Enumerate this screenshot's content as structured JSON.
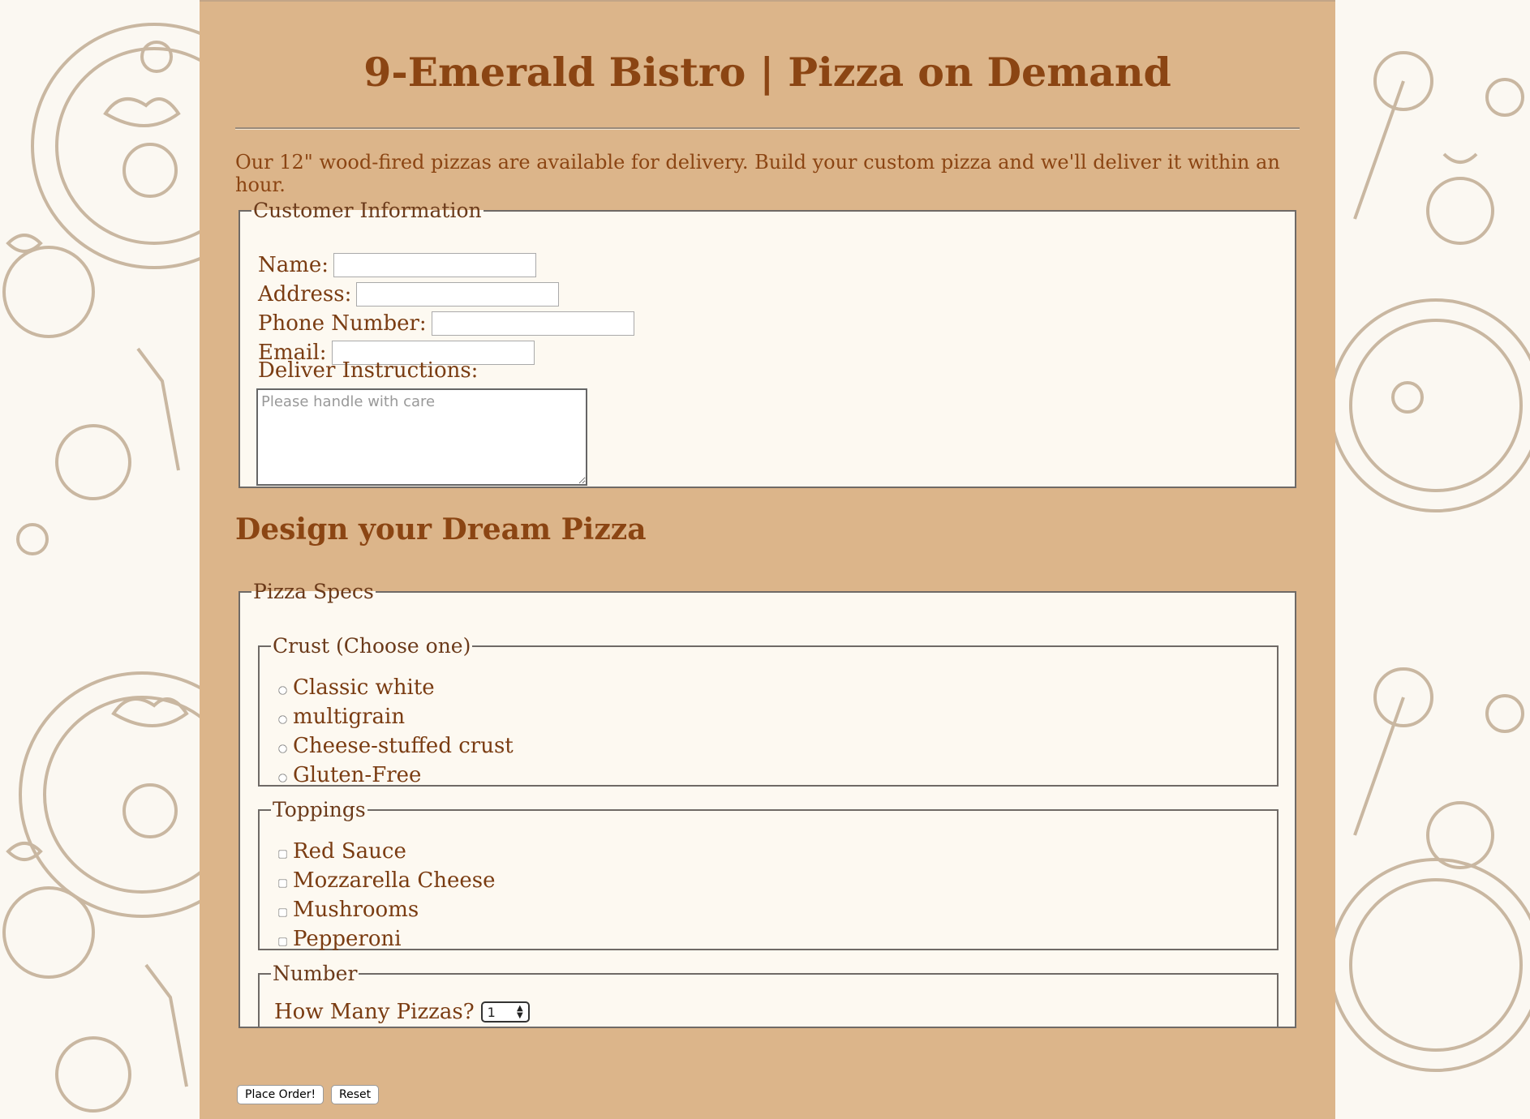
{
  "header": {
    "title": "9-Emerald Bistro | Pizza on Demand",
    "intro": "Our 12\" wood-fired pizzas are available for delivery. Build your custom pizza and we'll deliver it within an hour."
  },
  "customer": {
    "legend": "Customer Information",
    "name_label": "Name:",
    "address_label": "Address:",
    "phone_label": "Phone Number:",
    "email_label": "Email:",
    "instructions_label": "Deliver Instructions:",
    "instructions_placeholder": "Please handle with care"
  },
  "design": {
    "title": "Design your Dream Pizza"
  },
  "specs": {
    "legend": "Pizza Specs",
    "crust": {
      "legend": "Crust (Choose one)",
      "options": [
        "Classic white",
        "multigrain",
        "Cheese-stuffed crust",
        "Gluten-Free"
      ]
    },
    "toppings": {
      "legend": "Toppings",
      "options": [
        "Red Sauce",
        "Mozzarella Cheese",
        "Mushrooms",
        "Pepperoni"
      ]
    },
    "number": {
      "legend": "Number",
      "label": "How Many Pizzas?",
      "selected": "1"
    }
  },
  "actions": {
    "submit": "Place Order!",
    "reset": "Reset"
  },
  "colors": {
    "panel": "#dcb58a",
    "accent": "#8b4513",
    "fieldset_bg": "#fdf9f1"
  }
}
